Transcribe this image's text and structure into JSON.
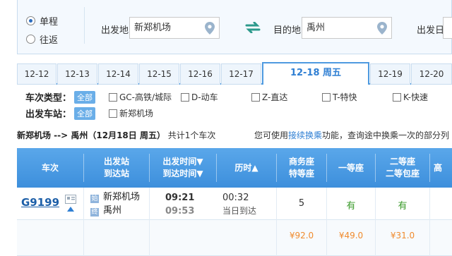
{
  "trip_type": {
    "one_way": "单程",
    "round_trip": "往返"
  },
  "search": {
    "from_label": "出发地",
    "from_value": "新郑机场",
    "to_label": "目的地",
    "to_value": "禹州",
    "date_label": "出发日"
  },
  "date_tabs": [
    "12-12",
    "12-13",
    "12-14",
    "12-15",
    "12-16",
    "12-17",
    "12-18 周五",
    "12-19",
    "12-20"
  ],
  "filters": {
    "type_title": "车次类型：",
    "all": "全部",
    "types": [
      "GC-高铁/城际",
      "D-动车",
      "Z-直达",
      "T-特快",
      "K-快速"
    ],
    "station_title": "出发车站：",
    "stations": [
      "新郑机场"
    ]
  },
  "summary": {
    "route": "新郑机场 --> 禹州（12月18日  周五）",
    "count": "共计1个车次",
    "hint_pre": "您可使用",
    "hint_link": "接续换乘",
    "hint_post": "功能，查询途中换乘一次的部分列"
  },
  "table": {
    "headers": {
      "train": "车次",
      "station_a": "出发站",
      "station_b": "到达站",
      "time_a": "出发时间▼",
      "time_b": "到达时间▼",
      "duration": "历时▲",
      "business_a": "商务座",
      "business_b": "特等座",
      "first": "一等座",
      "second_a": "二等座",
      "second_b": "二等包座",
      "next": "高"
    },
    "row": {
      "train_no": "G9199",
      "station_badge_from": "始",
      "from": "新郑机场",
      "station_badge_to": "终",
      "to": "禹州",
      "depart": "09:21",
      "arrive": "09:53",
      "duration": "00:32",
      "arrival_day": "当日到达",
      "business": "5",
      "first": "有",
      "second": "有",
      "price_business": "¥92.0",
      "price_first": "¥49.0",
      "price_second": "¥31.0"
    }
  }
}
